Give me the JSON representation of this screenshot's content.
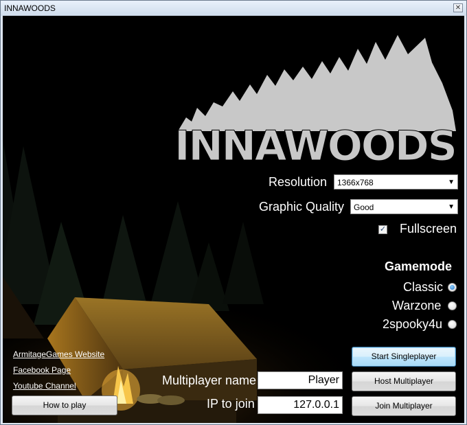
{
  "window": {
    "title": "INNAWOODS"
  },
  "logo": {
    "text": "INNAWOODS"
  },
  "settings": {
    "resolution_label": "Resolution",
    "resolution_value": "1366x768",
    "quality_label": "Graphic Quality",
    "quality_value": "Good",
    "fullscreen_label": "Fullscreen",
    "fullscreen_checked": true
  },
  "gamemode": {
    "heading": "Gamemode",
    "options": [
      {
        "label": "Classic",
        "selected": true
      },
      {
        "label": "Warzone",
        "selected": false
      },
      {
        "label": "2spooky4u",
        "selected": false
      }
    ]
  },
  "links": {
    "website": "ArmitageGames Website",
    "facebook": "Facebook Page",
    "youtube": "Youtube Channel"
  },
  "multiplayer": {
    "name_label": "Multiplayer name",
    "name_value": "Player",
    "ip_label": "IP to join",
    "ip_value": "127.0.0.1"
  },
  "buttons": {
    "how_to_play": "How to play",
    "start_single": "Start Singleplayer",
    "host_multi": "Host Multiplayer",
    "join_multi": "Join Multiplayer"
  },
  "colors": {
    "accent": "#3c7fb1",
    "logo": "#c8c8c8",
    "fire": "#f2b33a"
  },
  "icons": {
    "close": "close-icon",
    "combo_arrow": "chevron-down-icon",
    "checkmark": "checkmark-icon"
  }
}
